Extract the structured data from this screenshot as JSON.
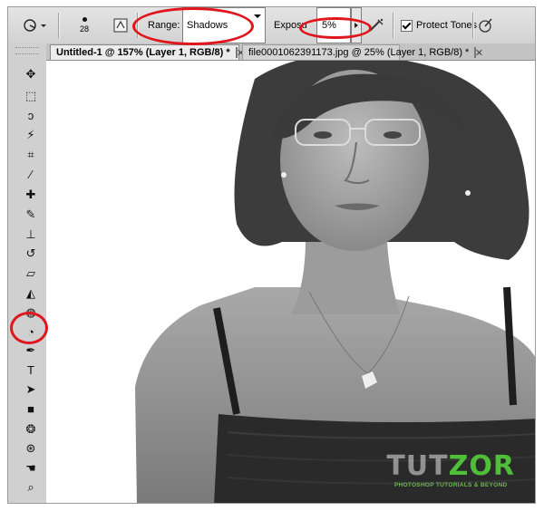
{
  "options_bar": {
    "tool_preset_icon": "dodge-burn-tool-icon",
    "brush_size": "28",
    "brush_panel_icon": "brush-panel-icon",
    "range_label": "Range:",
    "range_value": "Shadows",
    "exposure_label": "Exposure:",
    "exposure_label_visible": "Exposu",
    "exposure_value": "5%",
    "airbrush_icon": "airbrush-icon",
    "protect_tones_label": "Protect Tones",
    "protect_tones_checked": true,
    "pressure_icon": "tablet-pressure-icon"
  },
  "tabs": [
    {
      "label": "Untitled-1 @ 157% (Layer 1, RGB/8) *",
      "active": true
    },
    {
      "label": "file0001062391173.jpg @ 25% (Layer 1, RGB/8) *",
      "active": false
    }
  ],
  "tools": [
    {
      "name": "move-tool-icon",
      "glyph": "✥"
    },
    {
      "name": "marquee-tool-icon",
      "glyph": "⬚"
    },
    {
      "name": "lasso-tool-icon",
      "glyph": "ↄ"
    },
    {
      "name": "magic-wand-tool-icon",
      "glyph": "⚡"
    },
    {
      "name": "crop-tool-icon",
      "glyph": "⌗"
    },
    {
      "name": "eyedropper-tool-icon",
      "glyph": "⁄"
    },
    {
      "name": "spot-healing-tool-icon",
      "glyph": "✚"
    },
    {
      "name": "brush-tool-icon",
      "glyph": "✎"
    },
    {
      "name": "clone-stamp-tool-icon",
      "glyph": "⊥"
    },
    {
      "name": "history-brush-tool-icon",
      "glyph": "↺"
    },
    {
      "name": "eraser-tool-icon",
      "glyph": "▱"
    },
    {
      "name": "paint-bucket-tool-icon",
      "glyph": "◭"
    },
    {
      "name": "blur-tool-icon",
      "glyph": "◍"
    },
    {
      "name": "dodge-tool-icon",
      "glyph": "◔"
    },
    {
      "name": "pen-tool-icon",
      "glyph": "✒"
    },
    {
      "name": "type-tool-icon",
      "glyph": "T"
    },
    {
      "name": "path-selection-tool-icon",
      "glyph": "➤"
    },
    {
      "name": "rectangle-tool-icon",
      "glyph": "■"
    },
    {
      "name": "3d-rotate-tool-icon",
      "glyph": "❂"
    },
    {
      "name": "3d-orbit-tool-icon",
      "glyph": "⊛"
    },
    {
      "name": "hand-tool-icon",
      "glyph": "☚"
    },
    {
      "name": "zoom-tool-icon",
      "glyph": "⌕"
    }
  ],
  "watermark": {
    "brand_left": "TUT",
    "brand_right": "ZOR",
    "tagline": "PHOTOSHOP TUTORIALS & BEYOND",
    "accent": "#4fbf3a"
  },
  "annotation_color": "#e0161c"
}
